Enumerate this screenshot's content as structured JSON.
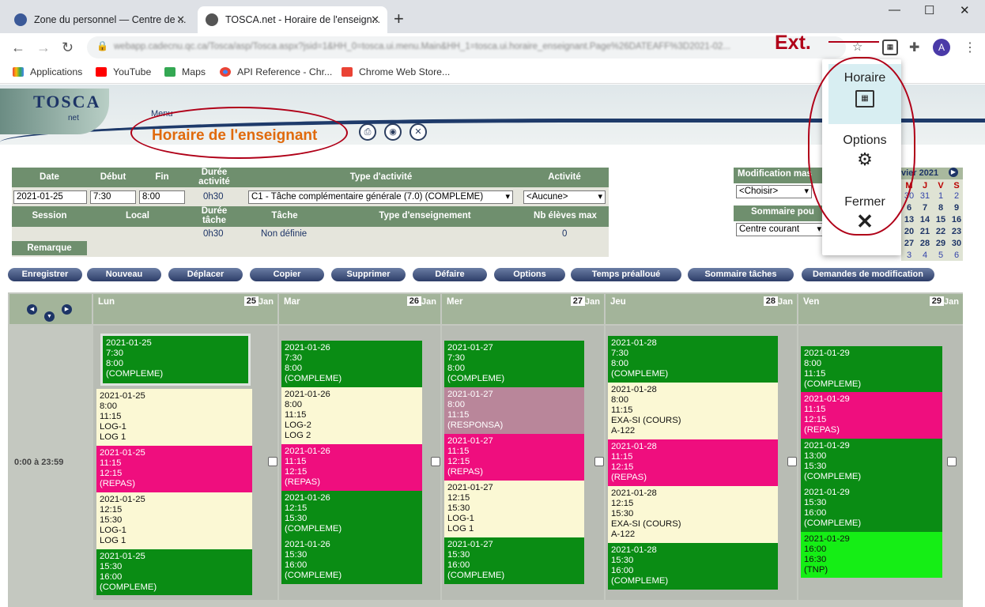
{
  "browser": {
    "tabs": [
      {
        "label": "Zone du personnel — Centre de ..."
      },
      {
        "label": "TOSCA.net - Horaire de l'enseign..."
      }
    ],
    "url": "webapp.cadecnu.qc.ca/Tosca/asp/Tosca.aspx?jsid=1&HH_0=tosca.ui.menu.Main&HH_1=tosca.ui.horaire_enseignant.Page%26DATEAFF%3D2021-02...",
    "profile": "A",
    "bookmarks": [
      "Applications",
      "YouTube",
      "Maps",
      "API Reference - Chr...",
      "Chrome Web Store..."
    ]
  },
  "header": {
    "menu": "Menu",
    "title": "Horaire de l'enseignant",
    "logo": "TOSCA",
    "logo_sub": "net"
  },
  "form": {
    "headers": {
      "date": "Date",
      "debut": "Début",
      "fin": "Fin",
      "duree": "Durée activité",
      "type": "Type d'activité",
      "activite": "Activité",
      "session": "Session",
      "local": "Local",
      "duree_tache": "Durée tâche",
      "tache": "Tâche",
      "type_ens": "Type d'enseignement",
      "nb": "Nb élèves max",
      "remarque": "Remarque"
    },
    "date": "2021-01-25",
    "debut": "7:30",
    "fin": "8:00",
    "duree": "0h30",
    "type_value": "C1 - Tâche complémentaire générale (7.0) (COMPLEME)",
    "activite_value": "<Aucune>",
    "duree_tache": "0h30",
    "tache": "Non définie",
    "nb": "0"
  },
  "right": {
    "modif_label": "Modification mas",
    "modif_value": "<Choisir>",
    "sommaire_label": "Sommaire pou",
    "sommaire_value": "Centre courant"
  },
  "calendar": {
    "month": "vier 2021",
    "head": [
      "M",
      "J",
      "V",
      "S"
    ],
    "rows": [
      [
        "30",
        "31",
        "1",
        "2"
      ],
      [
        "6",
        "7",
        "8",
        "9"
      ],
      [
        "13",
        "14",
        "15",
        "16"
      ],
      [
        "20",
        "21",
        "22",
        "23"
      ],
      [
        "27",
        "28",
        "29",
        "30"
      ],
      [
        "3",
        "4",
        "5",
        "6"
      ]
    ]
  },
  "buttons": [
    "Enregistrer",
    "Nouveau",
    "Déplacer",
    "Copier",
    "Supprimer",
    "Défaire",
    "Options",
    "Temps préalloué",
    "Sommaire tâches",
    "Demandes de modification"
  ],
  "time_label": "0:00 à 23:59",
  "days": [
    {
      "name": "Lun",
      "num": "25",
      "month": "Jan",
      "events": [
        "2021-01-25\n7:30\n8:00\n(COMPLEME)",
        "2021-01-25\n8:00\n11:15\nLOG-1\nLOG 1",
        "2021-01-25\n11:15\n12:15\n(REPAS)",
        "2021-01-25\n12:15\n15:30\nLOG-1\nLOG 1",
        "2021-01-25\n15:30\n16:00\n(COMPLEME)"
      ]
    },
    {
      "name": "Mar",
      "num": "26",
      "month": "Jan",
      "events": [
        "2021-01-26\n7:30\n8:00\n(COMPLEME)",
        "2021-01-26\n8:00\n11:15\nLOG-2\nLOG 2",
        "2021-01-26\n11:15\n12:15\n(REPAS)",
        "2021-01-26\n12:15\n15:30\n(COMPLEME)",
        "2021-01-26\n15:30\n16:00\n(COMPLEME)"
      ]
    },
    {
      "name": "Mer",
      "num": "27",
      "month": "Jan",
      "events": [
        "2021-01-27\n7:30\n8:00\n(COMPLEME)",
        "2021-01-27\n8:00\n11:15\n(RESPONSA)",
        "2021-01-27\n11:15\n12:15\n(REPAS)",
        "2021-01-27\n12:15\n15:30\nLOG-1\nLOG 1",
        "2021-01-27\n15:30\n16:00\n(COMPLEME)"
      ]
    },
    {
      "name": "Jeu",
      "num": "28",
      "month": "Jan",
      "events": [
        "2021-01-28\n7:30\n8:00\n(COMPLEME)",
        "2021-01-28\n8:00\n11:15\nEXA-SI (COURS)\nA-122",
        "2021-01-28\n11:15\n12:15\n(REPAS)",
        "2021-01-28\n12:15\n15:30\nEXA-SI (COURS)\nA-122",
        "2021-01-28\n15:30\n16:00\n(COMPLEME)"
      ]
    },
    {
      "name": "Ven",
      "num": "29",
      "month": "Jan",
      "events": [
        "2021-01-29\n8:00\n11:15\n(COMPLEME)",
        "2021-01-29\n11:15\n12:15\n(REPAS)",
        "2021-01-29\n13:00\n15:30\n(COMPLEME)",
        "2021-01-29\n15:30\n16:00\n(COMPLEME)",
        "2021-01-29\n16:00\n16:30\n(TNP)"
      ]
    }
  ],
  "popup": {
    "items": [
      "Horaire",
      "Options",
      "Fermer"
    ]
  },
  "annotation": "Ext."
}
